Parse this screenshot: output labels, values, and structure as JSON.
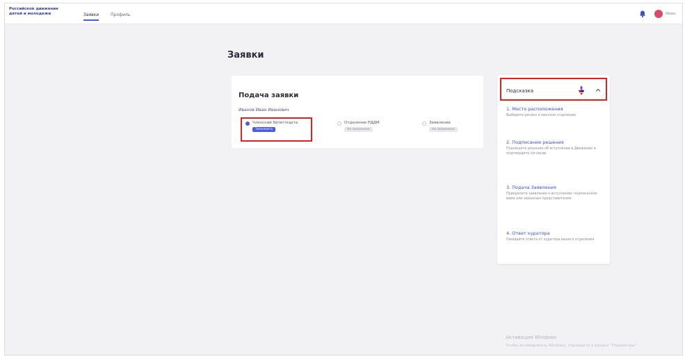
{
  "header": {
    "logo_line1": "Российское движение",
    "logo_line2": "детей и молодежи",
    "nav": [
      {
        "label": "Заявки"
      },
      {
        "label": "Профиль"
      }
    ],
    "user_name": "Иван"
  },
  "page": {
    "title": "Заявки"
  },
  "card": {
    "title": "Подача заявки",
    "person": "Иванов Иван Иванович",
    "options": [
      {
        "label": "Членский билет/карта",
        "badge": "Заполнить"
      },
      {
        "label": "Отделение РДДМ",
        "badge": "Не заполнено"
      },
      {
        "label": "Заявление",
        "badge": "Не заполнено"
      }
    ]
  },
  "hints": {
    "title": "Подсказка",
    "steps": [
      {
        "title": "1. Место расположения",
        "text": "Выберите регион и местное отделение"
      },
      {
        "title": "2. Подписание решения",
        "text": "Подпишите решение об вступлении в Движение и подтвердите согласие"
      },
      {
        "title": "3. Подача Заявления",
        "text": "Прикрепите заявление о вступлении, подписанное вами или законным представителем"
      },
      {
        "title": "4. Ответ куратора",
        "text": "Ожидайте ответа от куратора вашего отделения"
      }
    ]
  },
  "watermark": {
    "title": "Активация Windows",
    "subtitle": "Чтобы активировать Windows, перейдите в раздел \"Параметры\"."
  },
  "colors": {
    "accent": "#4a5bd8",
    "link": "#3d4fd1",
    "highlight": "#e02020",
    "background": "#f2f2f5"
  }
}
